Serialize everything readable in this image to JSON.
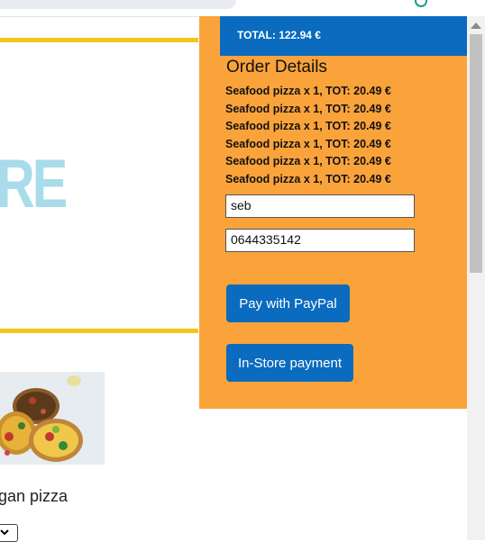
{
  "colors": {
    "panel": "#fba33b",
    "accent_blue": "#0a6bbf",
    "banner_border": "#f5c518",
    "banner_text": "#a8dcea"
  },
  "page": {
    "banner_text": "RE",
    "product_name": "gan pizza"
  },
  "order": {
    "total": "TOTAL: 122.94 €",
    "title": "Order Details",
    "items": [
      "Seafood pizza x 1, TOT: 20.49 €",
      "Seafood pizza x 1, TOT: 20.49 €",
      "Seafood pizza x 1, TOT: 20.49 €",
      "Seafood pizza x 1, TOT: 20.49 €",
      "Seafood pizza x 1, TOT: 20.49 €",
      "Seafood pizza x 1, TOT: 20.49 €"
    ],
    "name_value": "seb",
    "phone_value": "0644335142",
    "paypal_label": "Pay with PayPal",
    "instore_label": "In-Store payment"
  }
}
